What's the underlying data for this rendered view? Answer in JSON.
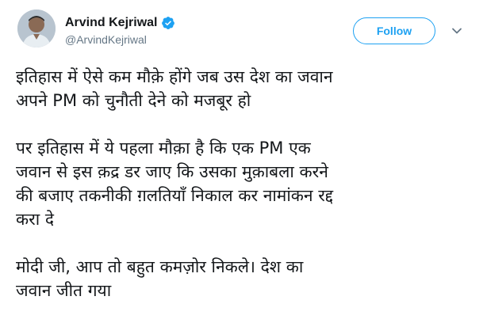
{
  "author": {
    "display_name": "Arvind Kejriwal",
    "handle": "@ArvindKejriwal",
    "verified": true,
    "avatar_icon": "profile-photo"
  },
  "actions": {
    "follow_label": "Follow",
    "menu_icon": "chevron-down-icon"
  },
  "colors": {
    "accent": "#1da1f2",
    "text": "#14171a",
    "secondary_text": "#657786"
  },
  "tweet": {
    "paragraphs": [
      {
        "lines": [
          "इतिहास में ऐसे कम मौक़े होंगे जब उस देश का जवान",
          "अपने PM को चुनौती देने को मजबूर हो"
        ]
      },
      {
        "lines": [
          "पर इतिहास में ये पहला मौक़ा है कि एक PM एक",
          "जवान से इस क़द्र डर जाए कि उसका मुक़ाबला करने",
          "की बजाए तकनीकी ग़लतियाँ निकाल कर नामांकन रद्द",
          "करा दे"
        ]
      },
      {
        "lines": [
          "मोदी जी, आप तो बहुत कमज़ोर निकले। देश का",
          "जवान जीत गया"
        ]
      }
    ]
  }
}
